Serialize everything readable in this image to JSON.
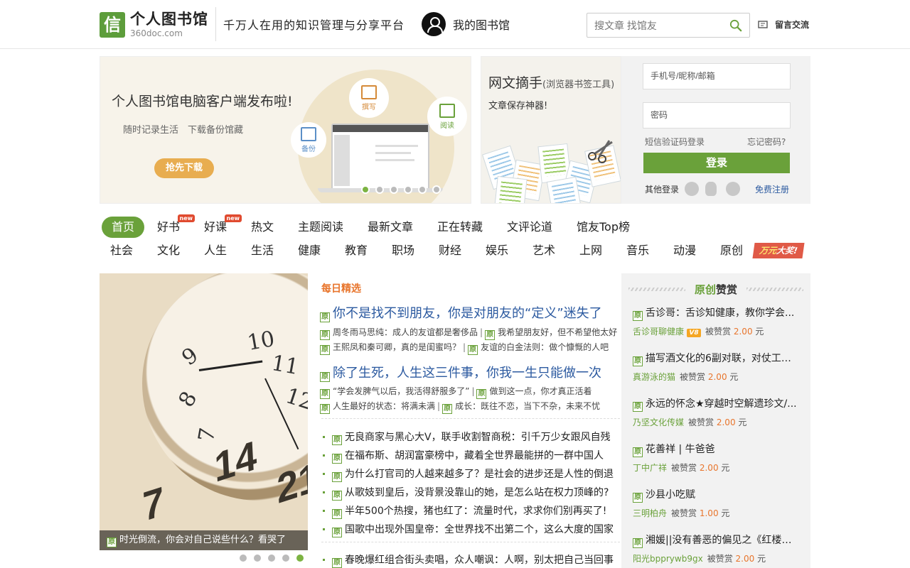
{
  "header": {
    "logo_icon_char": "信",
    "logo_text": "个人图书馆",
    "logo_sub": "360doc.com",
    "slogan": "千万人在用的知识管理与分享平台",
    "my_library": "我的图书馆",
    "search_placeholder": "搜文章 找馆友",
    "message_label": "留言交流"
  },
  "banner": {
    "title": "个人图书馆电脑客户端发布啦!",
    "subtitle": "随时记录生活　下载备份馆藏",
    "button": "抢先下载",
    "bubbles": [
      "撰写",
      "阅读",
      "备份"
    ]
  },
  "tool": {
    "title": "网文摘手",
    "title_small": "(浏览器书签工具)",
    "subtitle": "文章保存神器!"
  },
  "login": {
    "account_placeholder": "手机号/昵称/邮箱",
    "password_placeholder": "密码",
    "sms_login": "短信验证码登录",
    "forgot": "忘记密码?",
    "login_button": "登录",
    "other_login": "其他登录",
    "register": "免费注册"
  },
  "nav": {
    "row1": [
      "首页",
      "好书",
      "好课",
      "热文",
      "主题阅读",
      "最新文章",
      "正在转藏",
      "文评论道",
      "馆友Top榜"
    ],
    "new_badge": "new",
    "row2": [
      "社会",
      "文化",
      "人生",
      "生活",
      "健康",
      "教育",
      "职场",
      "财经",
      "娱乐",
      "艺术",
      "上网",
      "音乐",
      "动漫",
      "原创"
    ],
    "prize_a": "万元",
    "prize_b": "大奖!"
  },
  "hero": {
    "caption": "时光倒流，你会对自己说些什么？看哭了",
    "clock_numbers": [
      "10",
      "11",
      "12",
      "9",
      "8",
      "7"
    ],
    "calendar_numbers": [
      "14",
      "21",
      "7"
    ]
  },
  "yuan": "原",
  "daily": {
    "label": "每日精选",
    "headline1": "你不是找不到朋友，你是对朋友的“定义”迷失了",
    "sub1a": "周冬雨马思纯：成人的友谊都是奢侈品",
    "sub1b": "我希望朋友好，但不希望他太好",
    "sub1c": "王熙凤和秦可卿，真的是闺蜜吗？",
    "sub1d": "友谊的白金法则：做个慷慨的人吧",
    "headline2": "除了生死，人生这三件事，你我一生只能做一次",
    "sub2a": "“学会发脾气以后，我活得舒服多了”",
    "sub2b": "做到这一点，你才真正活着",
    "sub2c": "人生最好的状态：将满未满",
    "sub2d": "成长：既往不恋，当下不杂，未来不忧",
    "sep": "|",
    "list": [
      "无良商家与黑心大V，联手收割智商税：引千万少女跟风自残",
      "在福布斯、胡润富豪榜中，藏着全世界最能拼的一群中国人",
      "为什么打官司的人越来越多了？是社会的进步还是人性的倒退",
      "从歌妓到皇后，没背景没靠山的她，是怎么站在权力顶峰的?",
      "半年500个热搜，猪也红了：流量时代，求求你们别再买了!",
      "国歌中出现外国皇帝：全世界找不出第二个，这么大度的国家",
      "春晚爆红组合街头卖唱，众人嘲讽：人啊，别太把自己当回事"
    ]
  },
  "reward": {
    "head_a": "原创",
    "head_b": "赞赏",
    "rewarded_label": "被赞赏",
    "currency": "元",
    "v_badge": "V8",
    "items": [
      {
        "title": "舌诊哥：舌诊知健康，教你学会...",
        "author": "舌诊哥聊健康",
        "amount": "2.00"
      },
      {
        "title": "描写酒文化的6副对联，对仗工整...",
        "author": "真游泳的猫",
        "amount": "2.00"
      },
      {
        "title": "永远的怀念★穿越时空解遗珍文/...",
        "author": "乃坚文化传媒",
        "amount": "2.00"
      },
      {
        "title": "花善祥 | 牛爸爸",
        "author": "丁中广祥",
        "amount": "2.00"
      },
      {
        "title": "沙县小吃赋",
        "author": "三明柏舟",
        "amount": "1.00"
      },
      {
        "title": "湘媛||没有善恶的偏见之《红楼梦...",
        "author": "阳光bpprywb9gx",
        "amount": "2.00"
      }
    ]
  },
  "colors": {
    "brand_green": "#6aa13a",
    "accent_orange": "#e8752c",
    "link_blue": "#2c5aa0"
  }
}
